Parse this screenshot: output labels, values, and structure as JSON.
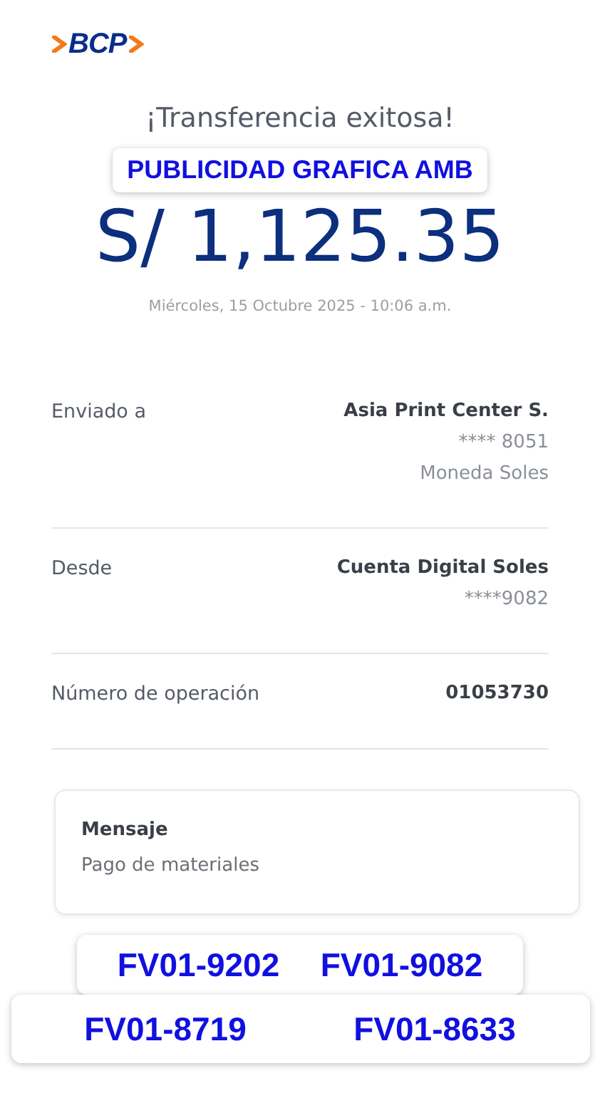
{
  "logo": {
    "text": "BCP"
  },
  "title": "¡Transferencia exitosa!",
  "overlay_label": "PUBLICIDAD GRAFICA AMB",
  "amount": "S/ 1,125.35",
  "date": "Miércoles, 15 Octubre 2025 - 10:06 a.m.",
  "details": [
    {
      "label": "Enviado a",
      "value": "Asia Print Center S.",
      "extra": [
        "**** 8051",
        "Moneda Soles"
      ]
    },
    {
      "label": "Desde",
      "value": "Cuenta Digital Soles",
      "extra": [
        "****9082"
      ]
    },
    {
      "label": "Número de operación",
      "value": "01053730"
    }
  ],
  "message": {
    "title": "Mensaje",
    "text": "Pago de materiales"
  },
  "invoice_rows": [
    [
      "FV01-9202",
      "FV01-9082"
    ],
    [
      "FV01-8719",
      "FV01-8633"
    ]
  ]
}
